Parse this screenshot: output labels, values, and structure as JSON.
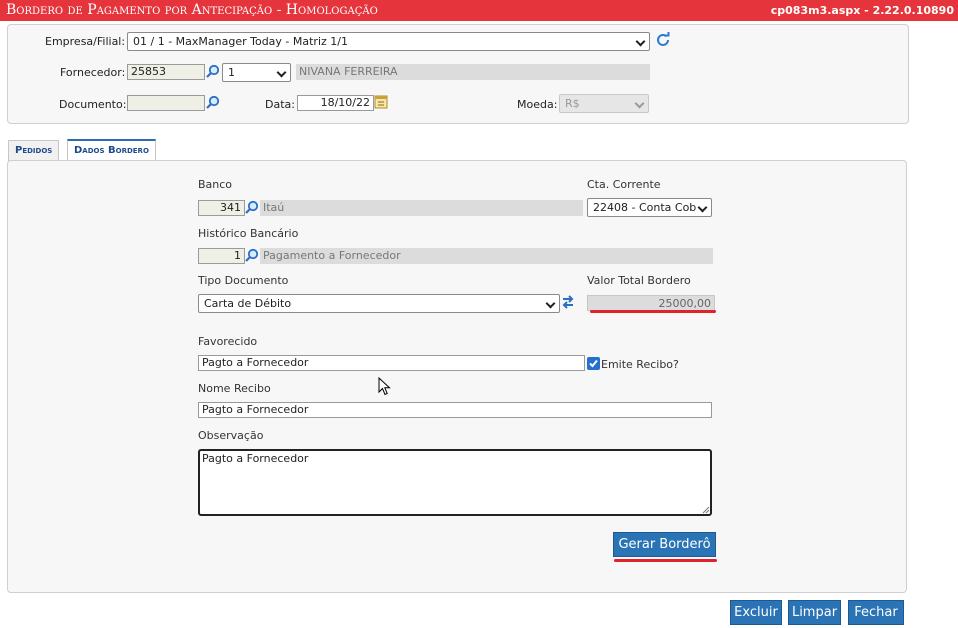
{
  "titlebar": {
    "title": "Bordero de Pagamento por Antecipação  - Homologação",
    "version": "cp083m3.aspx - 2.22.0.10890"
  },
  "header": {
    "empresa_label": "Empresa/Filial:",
    "empresa_value": "01 / 1 - MaxManager Today - Matriz 1/1",
    "fornecedor_label": "Fornecedor:",
    "fornecedor_code": "25853",
    "fornecedor_seq": "1",
    "fornecedor_name": "NIVANA FERREIRA",
    "documento_label": "Documento:",
    "documento_value": "",
    "data_label": "Data:",
    "data_value": "18/10/22",
    "moeda_label": "Moeda:",
    "moeda_value": "R$"
  },
  "tabs": [
    {
      "label": "Pedidos"
    },
    {
      "label": "Dados Bordero"
    }
  ],
  "form": {
    "banco_label": "Banco",
    "banco_code": "341",
    "banco_name": "Itaú",
    "cta_label": "Cta. Corrente",
    "cta_value": "22408 - Conta Cob",
    "historico_label": "Histórico Bancário",
    "historico_code": "1",
    "historico_name": "Pagamento a Fornecedor",
    "tipo_label": "Tipo Documento",
    "tipo_value": "Carta de Débito",
    "valor_label": "Valor Total Bordero",
    "valor_value": "25000,00",
    "favorecido_label": "Favorecido",
    "favorecido_value": "Pagto a Fornecedor",
    "emite_label": "Emite Recibo?",
    "emite_checked": true,
    "nome_recibo_label": "Nome Recibo",
    "nome_recibo_value": "Pagto a Fornecedor",
    "observacao_label": "Observação",
    "observacao_value": "Pagto a Fornecedor",
    "gerar_label": "Gerar Borderô"
  },
  "footer": {
    "excluir_label": "Excluir",
    "limpar_label": "Limpar",
    "fechar_label": "Fechar"
  },
  "colors": {
    "titlebar": "#e5343b",
    "button": "#2a74b5",
    "highlight": "#e0222b"
  },
  "icons": [
    "magnifier-icon",
    "refresh-icon",
    "calendar-icon",
    "mouse-cursor-icon"
  ]
}
